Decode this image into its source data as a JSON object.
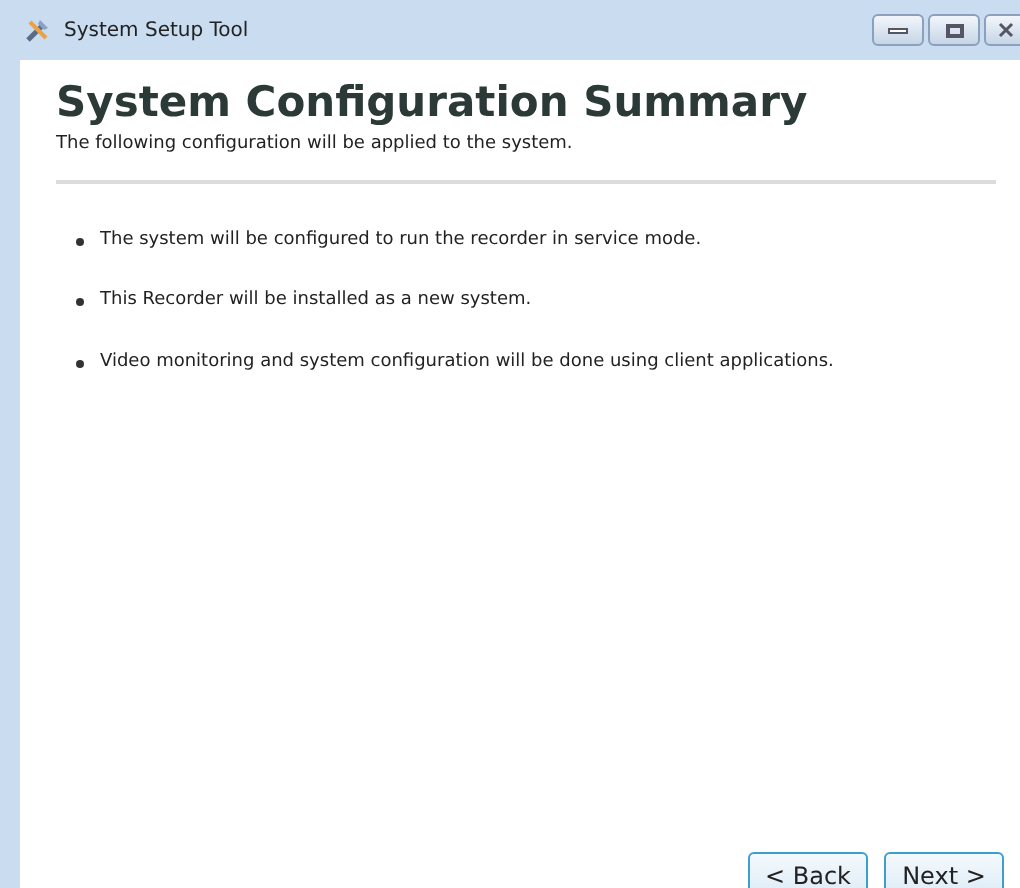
{
  "window": {
    "title": "System Setup Tool"
  },
  "header": {
    "title": "System Configuration Summary",
    "subtitle": "The following configuration will be applied to the system."
  },
  "items": [
    "The system will be configured to run the recorder in service mode.",
    "This Recorder will be installed as a new system.",
    "Video monitoring and system configuration will be done using client applications."
  ],
  "buttons": [
    {
      "label": "< Back"
    },
    {
      "label": "Next >"
    }
  ]
}
